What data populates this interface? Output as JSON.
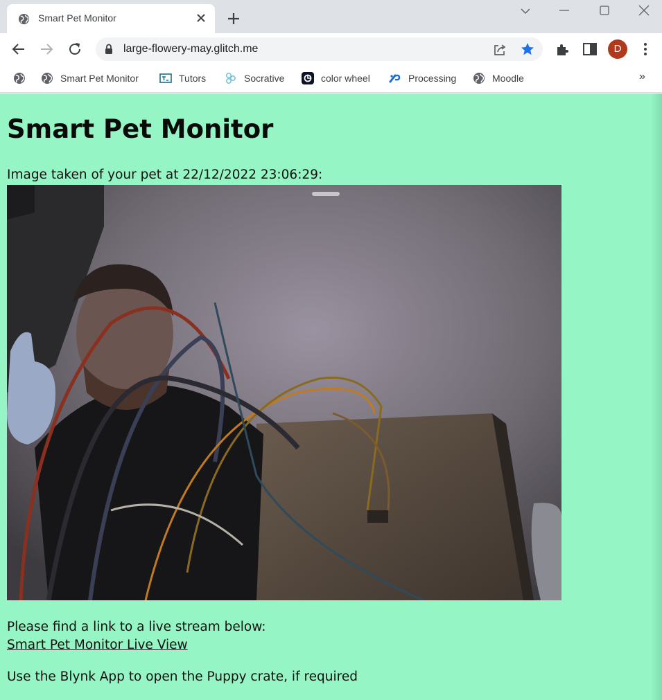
{
  "browser": {
    "tab": {
      "title": "Smart Pet Monitor",
      "favicon": "globe-icon"
    },
    "address_bar": {
      "url": "large-flowery-may.glitch.me"
    },
    "profile_initial": "D",
    "colors": {
      "tabstrip": "#dee1e6",
      "accent": "#1a73e8",
      "avatar": "#b03a1e"
    },
    "bookmarks": [
      {
        "label": "",
        "icon": "globe-icon"
      },
      {
        "label": "Smart Pet Monitor",
        "icon": "globe-icon"
      },
      {
        "label": "Tutors",
        "icon": "tutors-icon"
      },
      {
        "label": "Socrative",
        "icon": "socrative-icon"
      },
      {
        "label": "color wheel",
        "icon": "color-wheel-icon"
      },
      {
        "label": "Processing",
        "icon": "processing-icon"
      },
      {
        "label": "Moodle",
        "icon": "globe-icon"
      }
    ],
    "bookmarks_overflow": "»"
  },
  "page": {
    "background": "#95f5c4",
    "title": "Smart Pet Monitor",
    "image_caption": "Image taken of your pet at 22/12/2022 23:06:29:",
    "stream_text": "Please find a link to a live stream below:",
    "stream_link": "Smart Pet Monitor Live View",
    "blynk_text": "Use the Blynk App to open the Puppy crate, if required"
  }
}
